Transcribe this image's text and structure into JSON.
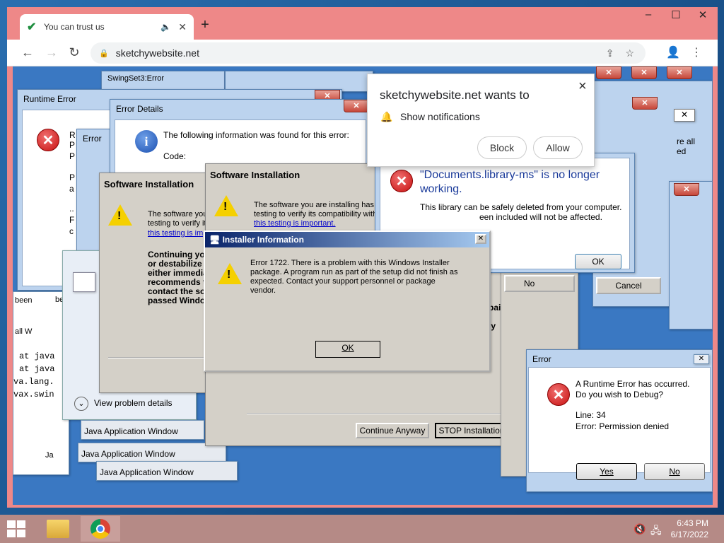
{
  "browser": {
    "tab_title": "You can trust us",
    "new_tab_symbol": "+",
    "url": "sketchywebsite.net",
    "window_controls": {
      "minimize": "–",
      "maximize": "☐",
      "close": "✕"
    }
  },
  "notification": {
    "title": "sketchywebsite.net wants to",
    "message": "Show notifications",
    "block_label": "Block",
    "allow_label": "Allow",
    "close": "×"
  },
  "dialogs": {
    "runtime_error": {
      "title": "Runtime Error",
      "lines": [
        "R",
        "P",
        "P",
        "P",
        "a",
        "..",
        "F",
        "c"
      ]
    },
    "error_small": {
      "title": "Error"
    },
    "error_details": {
      "title": "Error Details",
      "message": "The following information was found for this error:",
      "code_label": "Code:"
    },
    "software_install_1": {
      "title": "Software Installation",
      "text1": "The software you",
      "text2": "testing to verify its",
      "link": "this testing is imp",
      "bold1": "Continuing you",
      "bold2": "or destabilize",
      "bold3": "either immedia",
      "bold4": "recommends th",
      "bold5": "contact the so",
      "bold6": "passed Windo"
    },
    "software_install_2": {
      "title": "Software Installation",
      "text1": "The software you are installing has n",
      "text2": "testing to verify its compatibility with V",
      "link": "this testing is important.",
      "continue_label": "Continue Anyway",
      "stop_label": "STOP Installation",
      "partial1": "pair",
      "partial2": "ly"
    },
    "installer_info": {
      "title": "Installer Information",
      "message": "Error 1722. There is a problem with this Windows Installer package. A program run as part of the setup did not finish as expected. Contact your support personnel or package vendor.",
      "ok_label": "OK"
    },
    "documents_library": {
      "title": "\"Documents.library-ms\" is no longer working.",
      "text1": "This library can be safely deleted from your computer.",
      "text2": "een included will not be affected.",
      "ok_label": "OK",
      "cancel_label": "Cancel",
      "no_label": "No"
    },
    "runtime_debug": {
      "title": "Error",
      "line1": "A Runtime Error has occurred.",
      "line2": "Do you wish to Debug?",
      "line3": "Line: 34",
      "line4": "Error: Permission denied",
      "yes_label": "Yes",
      "no_label": "No"
    },
    "problem_details": {
      "label": "View problem details"
    },
    "java_windows": [
      "Java Application Window",
      "Java Application Window",
      "Java Application Window"
    ],
    "swing_title": "SwingSet3:Error",
    "stack": [
      "at java",
      "at java",
      "va.lang.",
      "vax.swin"
    ],
    "partial_texts": [
      "been",
      "be",
      "all W",
      "re all",
      "ed",
      "Ja"
    ]
  },
  "taskbar": {
    "time": "6:43 PM",
    "date": "6/17/2022"
  }
}
